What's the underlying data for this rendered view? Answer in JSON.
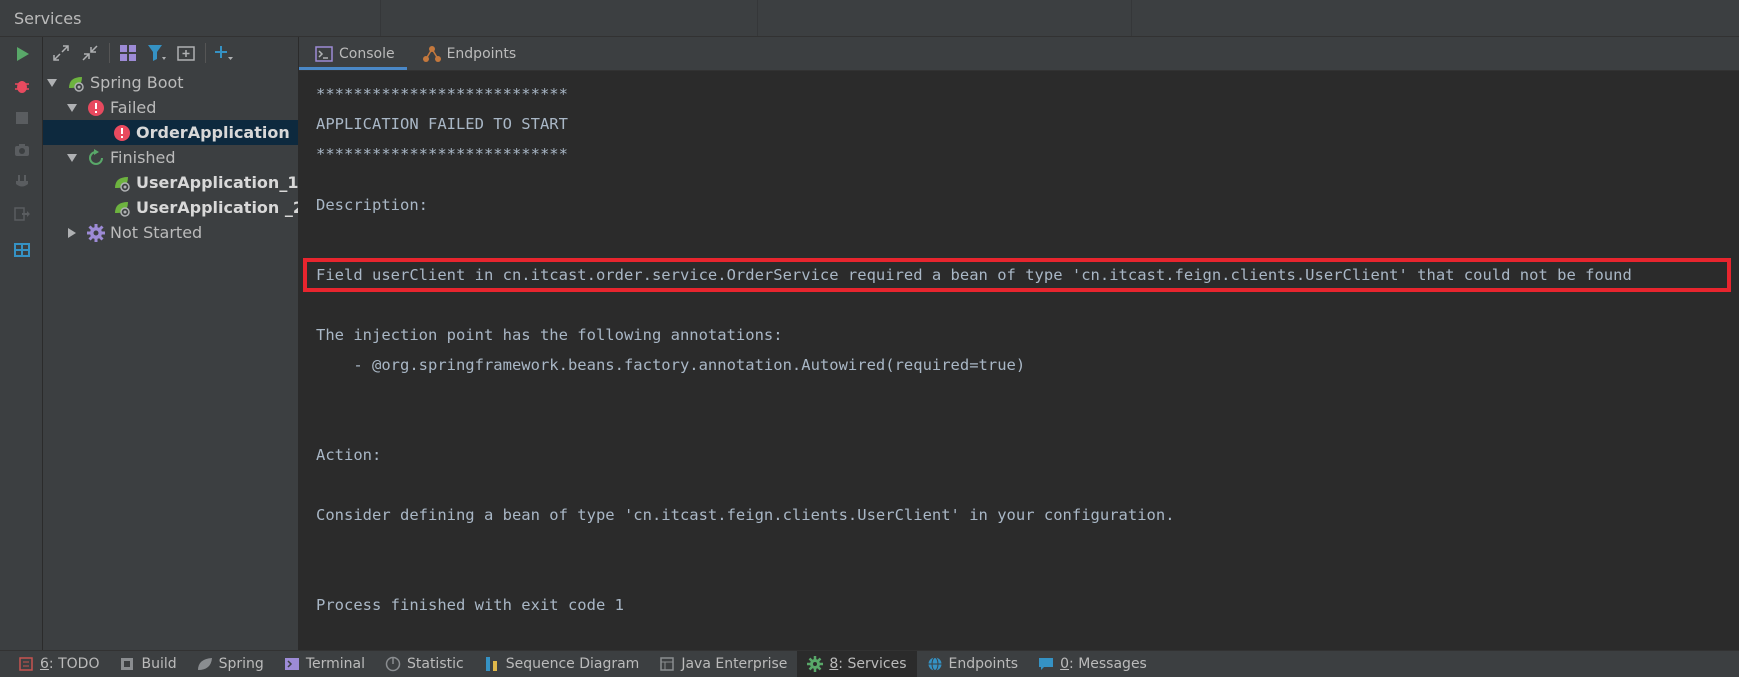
{
  "window": {
    "title": "Services"
  },
  "tree_toolbar": {
    "icons": [
      "expand-all-icon",
      "collapse-all-icon",
      "group-by-icon",
      "filter-icon",
      "new-window-icon",
      "add-service-icon"
    ]
  },
  "left_strip": {
    "icons": [
      "run-icon",
      "debug-icon",
      "stop-icon",
      "snapshot-icon",
      "attach-icon",
      "exit-icon",
      "layout-icon"
    ]
  },
  "tree": {
    "root": {
      "label": "Spring Boot"
    },
    "failed": {
      "label": "Failed"
    },
    "order_app": {
      "label": "OrderApplication"
    },
    "finished": {
      "label": "Finished"
    },
    "user_app_1": {
      "label": "UserApplication_1"
    },
    "user_app_2": {
      "label": "UserApplication _2"
    },
    "not_started": {
      "label": "Not Started"
    }
  },
  "tabs": [
    {
      "label": "Console",
      "active": true
    },
    {
      "label": "Endpoints",
      "active": false
    }
  ],
  "console": {
    "lines": [
      "***************************",
      "APPLICATION FAILED TO START",
      "***************************",
      "Description:",
      "Field userClient in cn.itcast.order.service.OrderService required a bean of type 'cn.itcast.feign.clients.UserClient' that could not be found",
      "The injection point has the following annotations:",
      "    - @org.springframework.beans.factory.annotation.Autowired(required=true)",
      "Action:",
      "Consider defining a bean of type 'cn.itcast.feign.clients.UserClient' in your configuration.",
      "Process finished with exit code 1"
    ]
  },
  "bottom_bar": {
    "items": [
      {
        "num": "6",
        "label": ": TODO"
      },
      {
        "num": "",
        "label": "Build"
      },
      {
        "num": "",
        "label": "Spring"
      },
      {
        "num": "",
        "label": "Terminal"
      },
      {
        "num": "",
        "label": "Statistic"
      },
      {
        "num": "",
        "label": "Sequence Diagram"
      },
      {
        "num": "",
        "label": "Java Enterprise"
      },
      {
        "num": "8",
        "label": ": Services"
      },
      {
        "num": "",
        "label": "Endpoints"
      },
      {
        "num": "0",
        "label": ": Messages"
      }
    ]
  },
  "colors": {
    "error": "#e84a5f",
    "run_green": "#59a869",
    "selection": "#0d293e",
    "highlight_border": "#e8252e",
    "tab_underline": "#4a88c7"
  }
}
